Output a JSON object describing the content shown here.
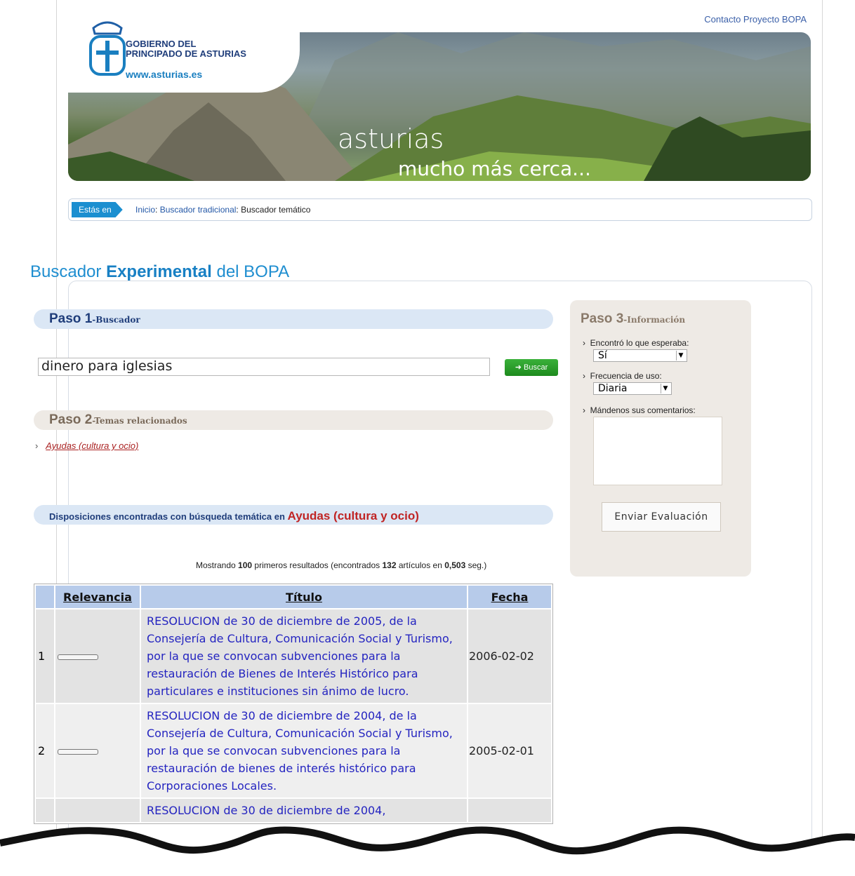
{
  "header": {
    "contact_link": "Contacto Proyecto BOPA",
    "logo_line1": "GOBIERNO DEL",
    "logo_line2": "PRINCIPADO DE ASTURIAS",
    "logo_url": "www.asturias.es",
    "slogan_line1": "asturias",
    "slogan_line2": "mucho más cerca..."
  },
  "breadcrumb": {
    "label": "Estás en",
    "item1": "Inicio",
    "sep1": ": ",
    "item2": "Buscador tradicional",
    "sep2": ": ",
    "current": "Buscador temático"
  },
  "title": {
    "part1": "Buscador ",
    "part2": "Experimental",
    "part3": " del BOPA"
  },
  "step1": {
    "label": "Paso 1",
    "sub": "-Buscador"
  },
  "search": {
    "value": "dinero para iglesias",
    "button": "Buscar"
  },
  "step2": {
    "label": "Paso 2",
    "sub": "-Temas relacionados"
  },
  "topics": [
    "Ayudas (cultura y ocio)"
  ],
  "results": {
    "prefix": "Disposiciones encontradas con búsqueda temática en ",
    "theme": "Ayudas (cultura y ocio)",
    "count_pre": "Mostrando ",
    "count_shown": "100",
    "count_mid": " primeros resultados (encontrados ",
    "count_found": "132",
    "count_mid2": " artículos en ",
    "count_time": "0,503",
    "count_post": " seg.)"
  },
  "table": {
    "headers": [
      "Relevancia",
      "Título",
      "Fecha"
    ],
    "rows": [
      {
        "n": "1",
        "title": "RESOLUCION de 30 de diciembre de 2005, de la Consejería de Cultura, Comunicación Social y Turismo, por la que se convocan subvenciones para la restauración de Bienes de Interés Histórico para particulares e instituciones sin ánimo de lucro.",
        "date": "2006-02-02"
      },
      {
        "n": "2",
        "title": "RESOLUCION de 30 de diciembre de 2004, de la Consejería de Cultura, Comunicación Social y Turismo, por la que se convocan subvenciones para la restauración de bienes de interés histórico para Corporaciones Locales.",
        "date": "2005-02-01"
      },
      {
        "n": "",
        "title": "RESOLUCION de 30 de diciembre de 2004,",
        "date": ""
      }
    ]
  },
  "sidebar": {
    "label": "Paso 3",
    "sub": "-Información",
    "q1": "Encontró lo que esperaba:",
    "q1_value": "Sí",
    "q2": "Frecuencia de uso:",
    "q2_value": "Diaria",
    "q3": "Mándenos sus comentarios:",
    "submit": "Enviar Evaluación"
  }
}
